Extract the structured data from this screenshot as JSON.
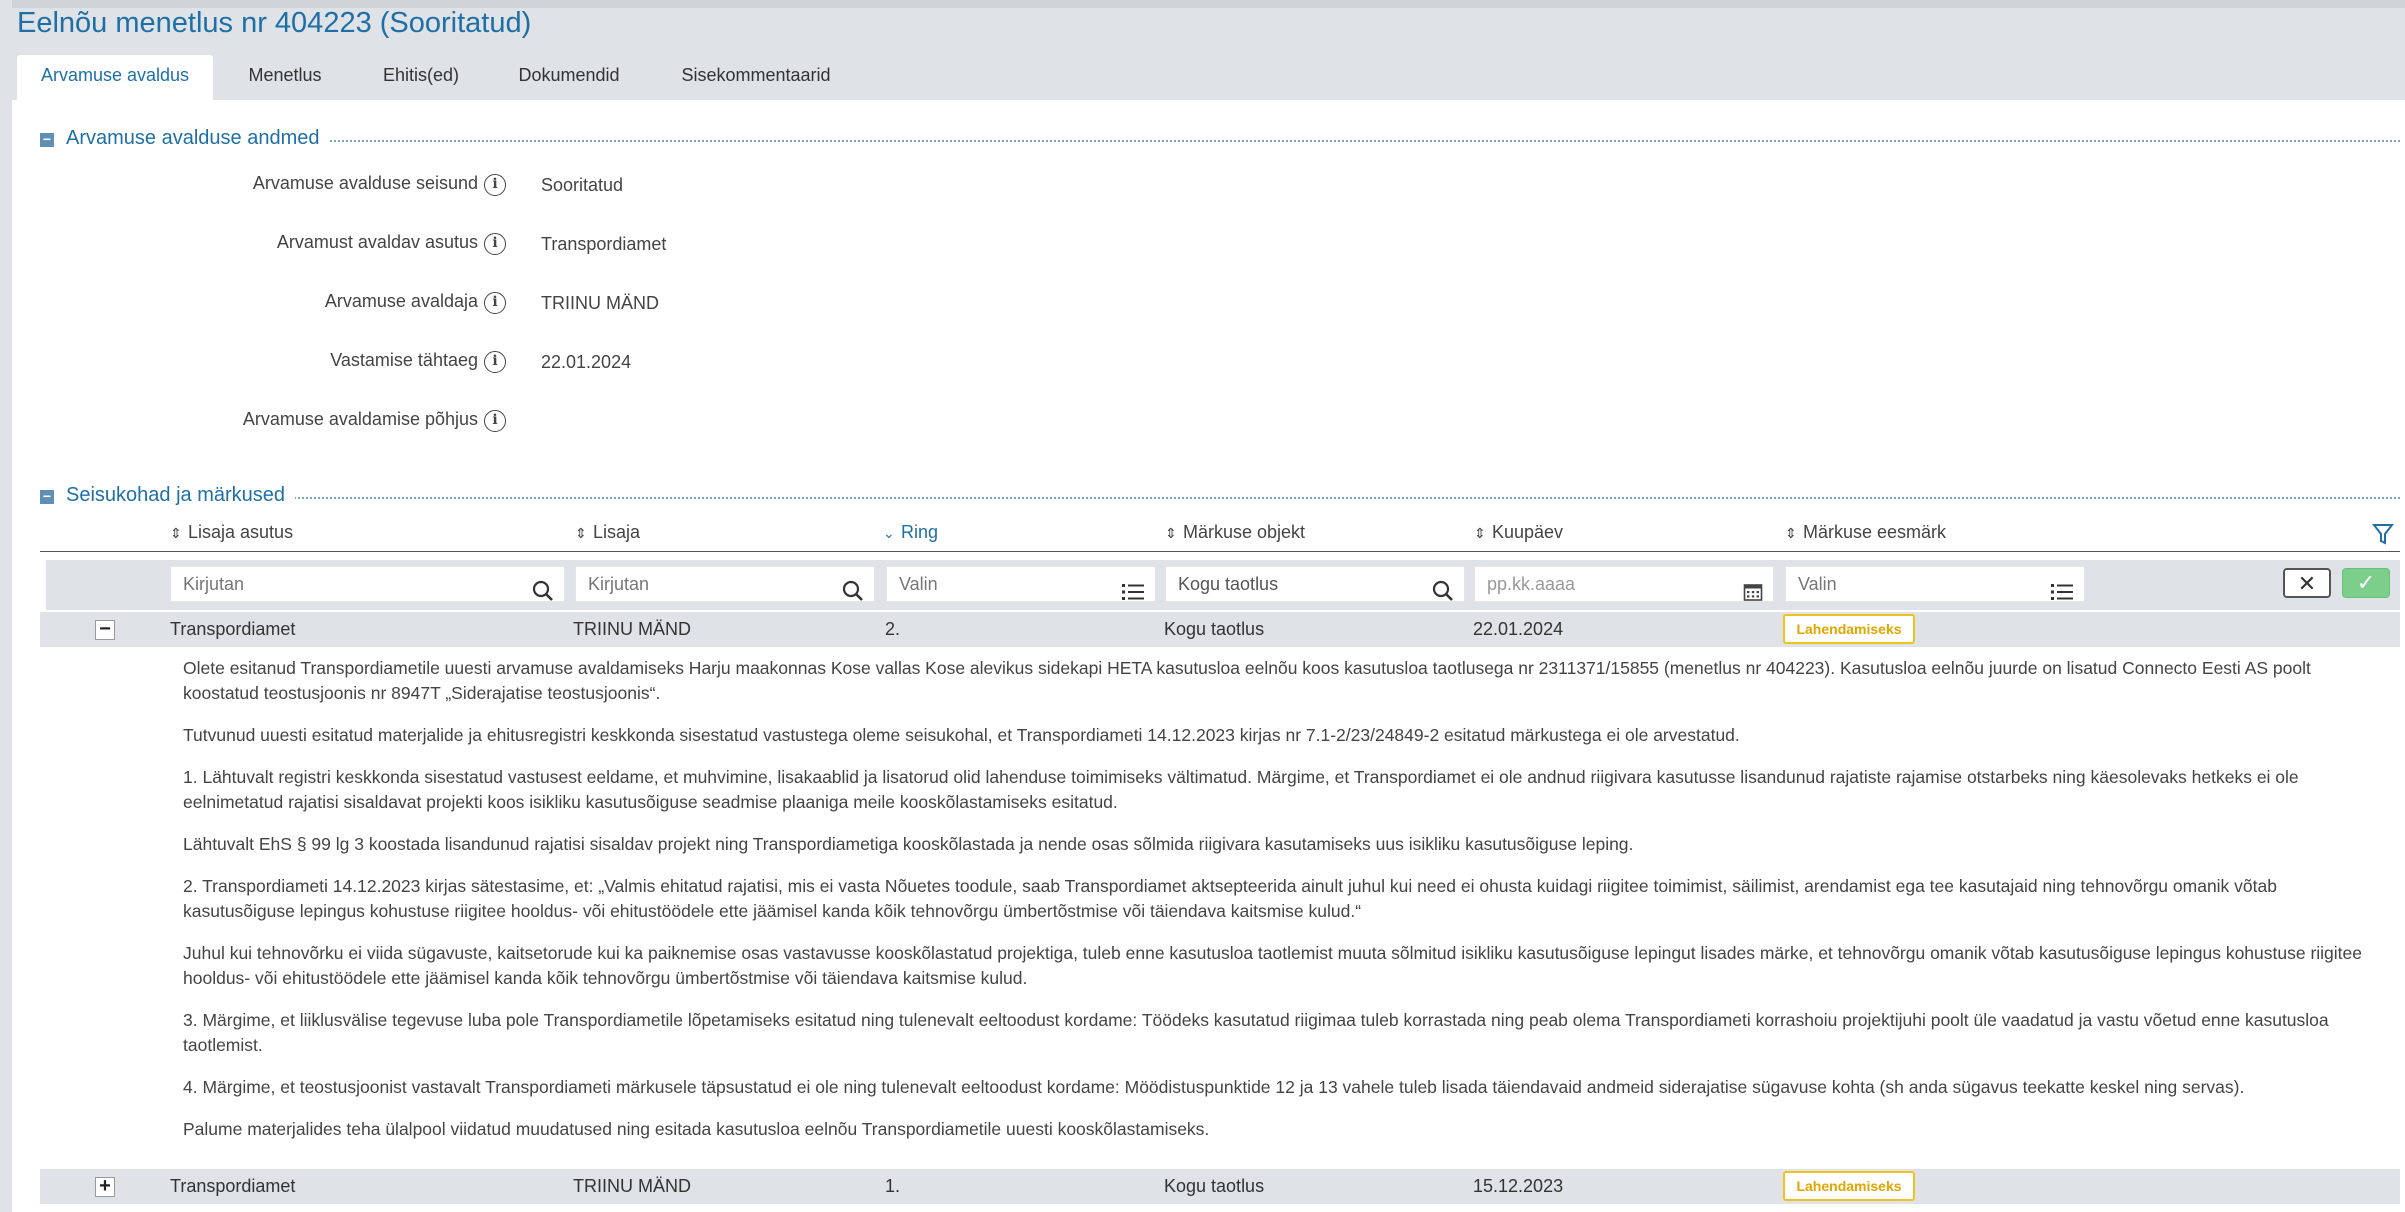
{
  "header": {
    "title": "Eelnõu menetlus nr 404223 (Sooritatud)"
  },
  "tabs": [
    {
      "label": "Arvamuse avaldus",
      "active": true
    },
    {
      "label": "Menetlus",
      "active": false
    },
    {
      "label": "Ehitis(ed)",
      "active": false
    },
    {
      "label": "Dokumendid",
      "active": false
    },
    {
      "label": "Sisekommentaarid",
      "active": false
    }
  ],
  "section1": {
    "title": "Arvamuse avalduse andmed",
    "toggle": "−",
    "fields": [
      {
        "label": "Arvamuse avalduse seisund",
        "value": "Sooritatud"
      },
      {
        "label": "Arvamust avaldav asutus",
        "value": "Transpordiamet"
      },
      {
        "label": "Arvamuse avaldaja",
        "value": "TRIINU MÄND"
      },
      {
        "label": "Vastamise tähtaeg",
        "value": "22.01.2024"
      },
      {
        "label": "Arvamuse avaldamise põhjus",
        "value": ""
      }
    ]
  },
  "section2": {
    "title": "Seisukohad ja märkused",
    "toggle": "−",
    "columns": [
      {
        "label": "Lisaja asutus",
        "sort": "⇕"
      },
      {
        "label": "Lisaja",
        "sort": "⇕"
      },
      {
        "label": "Ring",
        "sort": "⌄"
      },
      {
        "label": "Märkuse objekt",
        "sort": "⇕"
      },
      {
        "label": "Kuupäev",
        "sort": "⇕"
      },
      {
        "label": "Märkuse eesmärk",
        "sort": "⇕"
      }
    ],
    "filters": [
      {
        "placeholder": "Kirjutan",
        "value": ""
      },
      {
        "placeholder": "Kirjutan",
        "value": ""
      },
      {
        "placeholder": "Valin",
        "value": ""
      },
      {
        "placeholder": "",
        "value": "Kogu taotlus"
      },
      {
        "placeholder": "pp.kk.aaaa",
        "value": ""
      },
      {
        "placeholder": "Valin",
        "value": ""
      }
    ],
    "rows": [
      {
        "toggle": "−",
        "asutus": "Transpordiamet",
        "lisaja": "TRIINU MÄND",
        "ring": "2.",
        "objekt": "Kogu taotlus",
        "kuupaev": "22.01.2024",
        "eesmark": "Lahendamiseks"
      },
      {
        "toggle": "+",
        "asutus": "Transpordiamet",
        "lisaja": "TRIINU MÄND",
        "ring": "1.",
        "objekt": "Kogu taotlus",
        "kuupaev": "15.12.2023",
        "eesmark": "Lahendamiseks"
      }
    ],
    "comment": [
      "Olete esitanud Transpordiametile uuesti arvamuse avaldamiseks Harju maakonnas Kose vallas Kose alevikus sidekapi HETA kasutusloa eelnõu koos kasutusloa taotlusega nr 2311371/15855 (menetlus nr 404223). Kasutusloa eelnõu juurde on lisatud Connecto Eesti AS poolt koostatud teostusjoonis nr 8947T „Siderajatise teostusjoonis“.",
      "Tutvunud uuesti esitatud materjalide ja ehitusregistri keskkonda sisestatud vastustega oleme seisukohal, et Transpordiameti 14.12.2023 kirjas nr 7.1-2/23/24849-2 esitatud märkustega ei ole arvestatud.",
      "1. Lähtuvalt registri keskkonda sisestatud vastusest eeldame, et muhvimine, lisakaablid ja lisatorud olid lahenduse toimimiseks vältimatud. Märgime, et Transpordiamet ei ole andnud riigivara kasutusse lisandunud rajatiste rajamise otstarbeks ning käesolevaks hetkeks ei ole eelnimetatud rajatisi sisaldavat projekti koos isikliku kasutusõiguse seadmise plaaniga meile kooskõlastamiseks esitatud.",
      "Lähtuvalt EhS § 99 lg 3 koostada lisandunud rajatisi sisaldav projekt ning Transpordiametiga kooskõlastada ja nende osas sõlmida riigivara kasutamiseks uus isikliku kasutusõiguse leping.",
      "2. Transpordiameti 14.12.2023 kirjas sätestasime, et: „Valmis ehitatud rajatisi, mis ei vasta Nõuetes toodule, saab Transpordiamet aktsepteerida ainult juhul kui need ei ohusta kuidagi riigitee toimimist, säilimist, arendamist ega tee kasutajaid ning tehnovõrgu omanik võtab kasutusõiguse lepingus kohustuse riigitee hooldus- või ehitustöödele ette jäämisel kanda kõik tehnovõrgu ümbertõstmise või täiendava kaitsmise kulud.“",
      "Juhul kui tehnovõrku ei viida sügavuste, kaitsetorude kui ka paiknemise osas vastavusse kooskõlastatud projektiga, tuleb enne kasutusloa taotlemist muuta sõlmitud isikliku kasutusõiguse lepingut lisades märke, et tehnovõrgu omanik võtab kasutusõiguse lepingus kohustuse riigitee hooldus- või ehitustöödele ette jäämisel kanda kõik tehnovõrgu ümbertõstmise või täiendava kaitsmise kulud.",
      "3. Märgime, et liiklusvälise tegevuse luba pole Transpordiametile lõpetamiseks esitatud ning tulenevalt eeltoodust kordame: Töödeks kasutatud riigimaa tuleb korrastada ning peab olema Transpordiameti korrashoiu projektijuhi poolt üle vaadatud ja vastu võetud enne kasutusloa taotlemist.",
      "4. Märgime, et teostusjoonist vastavalt Transpordiameti märkusele täpsustatud ei ole ning tulenevalt eeltoodust kordame: Möödistuspunktide 12 ja 13 vahele tuleb lisada täiendavaid andmeid siderajatise sügavuse kohta (sh anda sügavus teekatte keskel ning servas).",
      "Palume materjalides teha ülalpool viidatud muudatused ning esitada kasutusloa eelnõu Transpordiametile uuesti kooskõlastamiseks."
    ],
    "buttons": {
      "clear": "✕",
      "apply": "✓"
    }
  },
  "colors": {
    "accent": "#1f6fa7",
    "panel": "#dfe2e6",
    "badge": "#f1c31a",
    "apply": "#7ccf8a"
  },
  "icons": [
    "info-icon",
    "search-icon",
    "list-icon",
    "calendar-icon",
    "filter-icon",
    "sort-icon",
    "close-icon",
    "check-icon"
  ]
}
